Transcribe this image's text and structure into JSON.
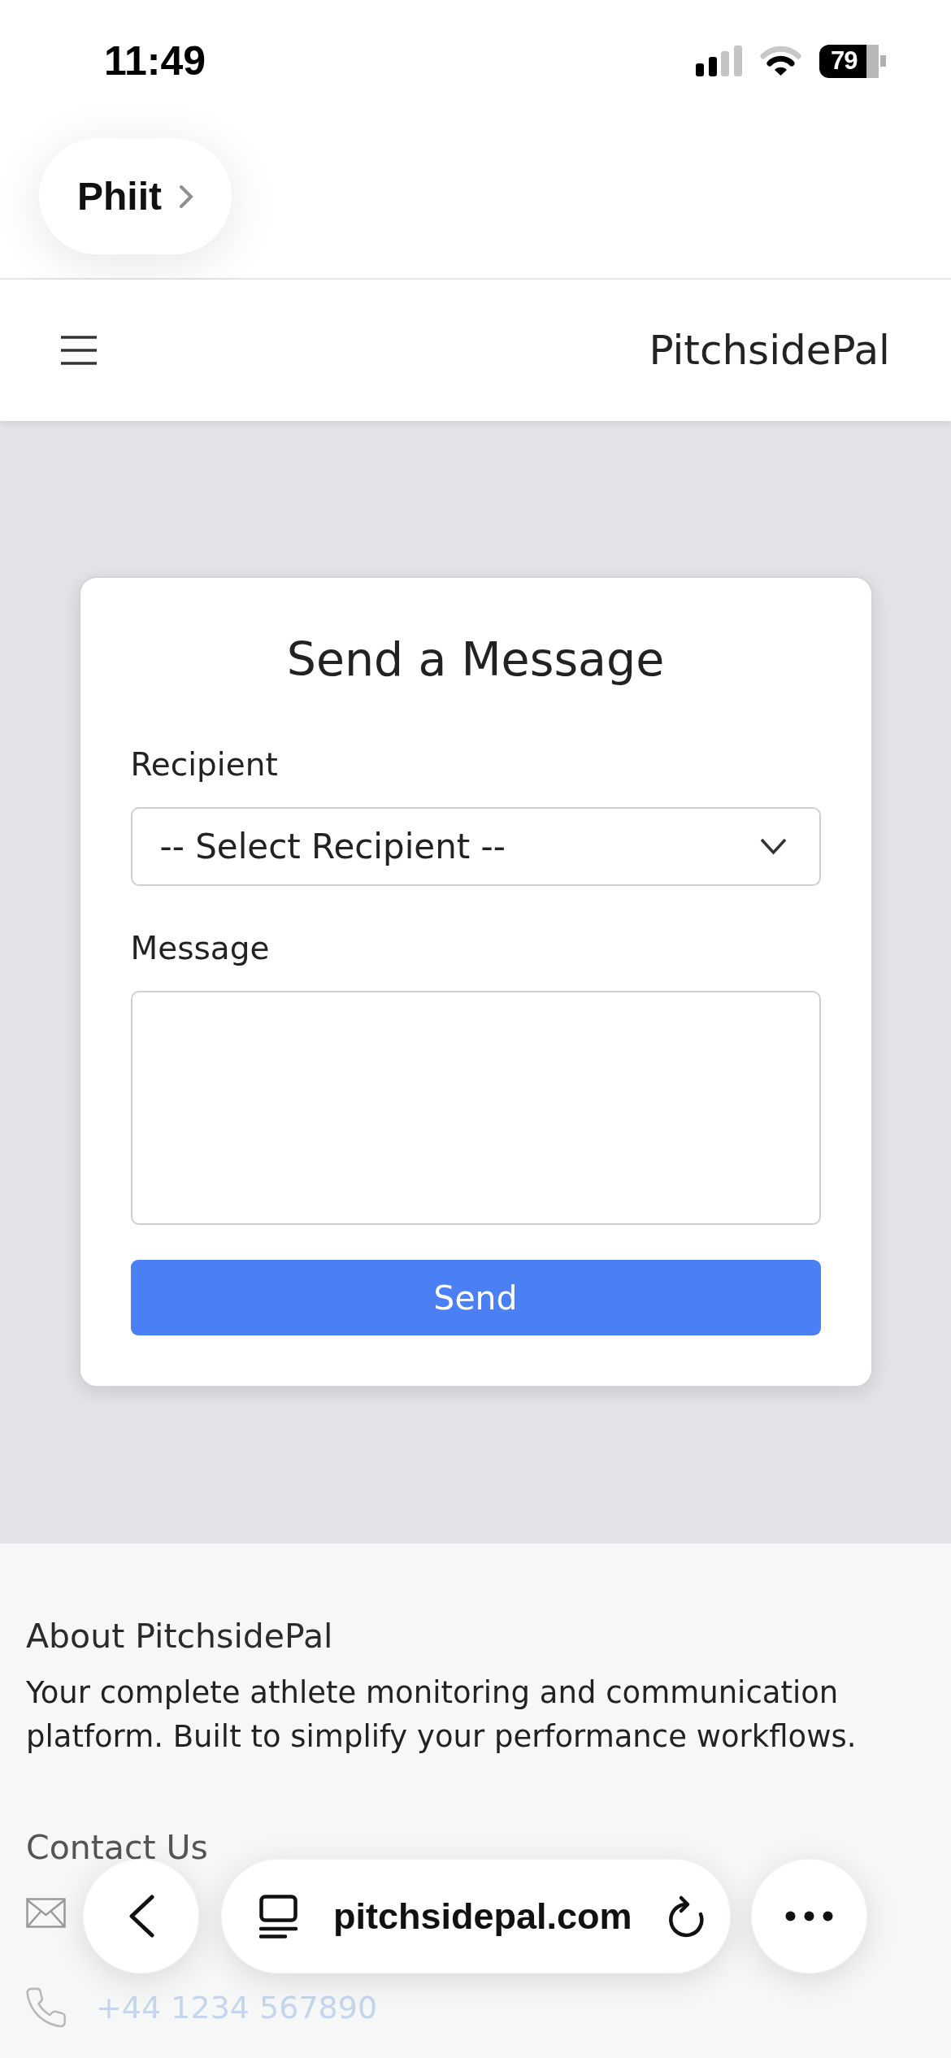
{
  "status_bar": {
    "time": "11:49",
    "battery": "79"
  },
  "app_switcher": {
    "label": "Phiit"
  },
  "navbar": {
    "brand": "PitchsidePal"
  },
  "form": {
    "title": "Send a Message",
    "fields": [
      {
        "kind": "select",
        "label": "Recipient",
        "value": "-- Select Recipient --"
      },
      {
        "kind": "textarea",
        "label": "Message"
      }
    ],
    "submit": "Send"
  },
  "footer": {
    "about": {
      "heading": "About PitchsidePal",
      "text": "Your complete athlete monitoring and communication platform. Built to simplify your performance workflows."
    },
    "contact": {
      "heading": "Contact Us",
      "items": [
        {
          "kind": "email"
        },
        {
          "kind": "phone",
          "text": "+44 1234 567890"
        }
      ]
    }
  },
  "browser_toolbar": {
    "url": "pitchsidepal.com"
  }
}
